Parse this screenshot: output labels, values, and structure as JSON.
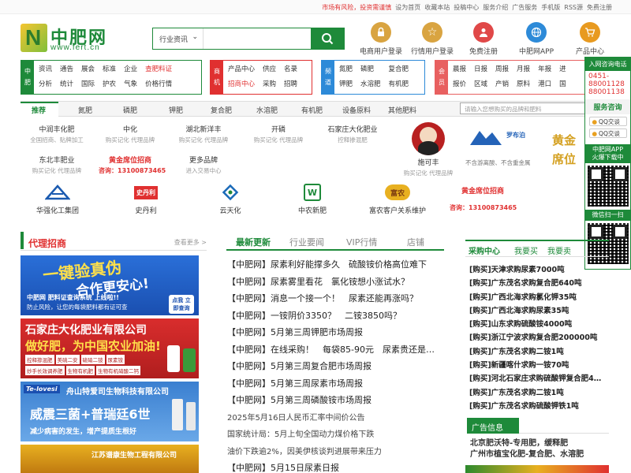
{
  "topbar": {
    "warning": "市场有风险，投资需谨慎",
    "links": [
      "设为首页",
      "收藏本站",
      "投稿中心",
      "服务介绍",
      "广告服务",
      "手机版",
      "RSS源",
      "免费注册"
    ]
  },
  "logo": {
    "name": "中肥网",
    "url": "www.fert.cn",
    "letter": "N"
  },
  "search": {
    "category": "行业资讯",
    "placeholder": ""
  },
  "quick_links": [
    {
      "label": "电商用户登录",
      "icon": "lock-icon",
      "color": "#d9a441"
    },
    {
      "label": "行情用户登录",
      "icon": "star-icon",
      "color": "#d9a441"
    },
    {
      "label": "免费注册",
      "icon": "user-icon",
      "color": "#e04848"
    },
    {
      "label": "中肥网APP",
      "icon": "globe-icon",
      "color": "#2d8ad8"
    },
    {
      "label": "产品中心",
      "icon": "cart-icon",
      "color": "#e89a20"
    }
  ],
  "nav": {
    "zhongfei": {
      "tag": [
        "中",
        "肥"
      ],
      "items": [
        "资讯",
        "通告",
        "展会",
        "标准",
        "企业",
        "查肥料证",
        "分析",
        "统计",
        "国际",
        "护农",
        "气象",
        "价格行情"
      ]
    },
    "shangji": {
      "tag": [
        "商",
        "机"
      ],
      "items": [
        "产品中心",
        "供应",
        "名录",
        "招商中心",
        "采购",
        "招聘"
      ]
    },
    "pindao": {
      "tag": [
        "频",
        "道"
      ],
      "items": [
        "氮肥",
        "磷肥",
        "复合肥",
        "钾肥",
        "水溶肥",
        "有机肥"
      ]
    },
    "huiyuan": {
      "tag": [
        "会",
        "员"
      ],
      "items": [
        "晨报",
        "日报",
        "周报",
        "月报",
        "年报",
        "进",
        "报价",
        "区域",
        "产销",
        "原料",
        "港口",
        "国"
      ]
    }
  },
  "rec_tabs": [
    "推荐",
    "氮肥",
    "磷肥",
    "钾肥",
    "复合肥",
    "水溶肥",
    "有机肥",
    "设备原料",
    "其他肥料"
  ],
  "rec_search_placeholder": "请输入您想购买的品牌和肥料",
  "brands_row1": [
    {
      "name": "中润丰化肥",
      "sub": "全国招商、贴牌加工"
    },
    {
      "name": "中化",
      "sub": "购买记化 代理品牌"
    },
    {
      "name": "湖北新洋丰",
      "sub": "购买记化 代理品牌"
    },
    {
      "name": "开磷",
      "sub": "购买记化 代理品牌"
    },
    {
      "name": "石家庄大化肥业",
      "sub": "控释掺混肥"
    }
  ],
  "brands_row2": [
    {
      "name": "东北丰肥业",
      "sub": "购买记化 代理品牌"
    },
    {
      "name": "黄金席位招商",
      "sub": "咨询：13100873465"
    },
    {
      "name": "更多品牌",
      "sub": "进入交易中心"
    }
  ],
  "brand_feature": {
    "name": "施可丰",
    "sub": "购买记化 代理品牌",
    "luobu_text": "不含游离酸、不含重金属",
    "luobu_logo": "罗布泊",
    "gold_text": "黄金席位招商"
  },
  "brand_logos": [
    "华强化工集团",
    "史丹利",
    "云天化",
    "中农新肥",
    "富农客户关系维护"
  ],
  "brand_logos_cta": {
    "name": "黄金席位招商",
    "sub": "咨询：13100873465"
  },
  "float": {
    "header": "入网咨询电话",
    "phones": [
      "0451-",
      "88001128",
      "88001138"
    ],
    "service": "服务咨询",
    "qq": [
      "QQ交谈",
      "QQ交谈"
    ],
    "app": [
      "中肥网APP",
      "火爆下载中"
    ],
    "wechat": "微信扫一扫"
  },
  "agency": {
    "title": "代理招商",
    "more": "查看更多 >"
  },
  "ads": {
    "ad1": {
      "line1": "一键验真伪",
      "line2": "合作更安心!",
      "line3": "中肥网 肥料证查询系统 上线啦!!",
      "line4": "防止风险，让您的每袋肥料都有证可查",
      "line5": "点我 立即查询"
    },
    "ad2": {
      "line1": "石家庄大化肥业有限公司",
      "line2": "做好肥，为中国农业加油!",
      "tags": [
        "控释掺混肥",
        "美硫二安",
        "硫硝二铵",
        "尿素铵",
        "妙手长效调养肥",
        "生物有机肥",
        "生物有机硝酸二钙"
      ]
    },
    "ad3": {
      "line1": "舟山特爱司生物科技有限公司",
      "line2": "威震三菌+普瑞廷6世",
      "line3": "减少病害的发生，增产提质生根好",
      "brand": "Te-lovesi"
    },
    "ad4": {
      "line1": "江苏谱康生物工程有限公司"
    }
  },
  "news_tabs": [
    "最新更新",
    "行业要闻",
    "VIP行情",
    "店铺"
  ],
  "news": [
    "【中肥网】尿素利好能撑多久　硫酸铵价格高位难下",
    "【中肥网】尿素雾里看花　氯化铵想小涨试水？",
    "【中肥网】消息一个接一个！　尿素还能再涨吗？",
    "【中肥网】一铵阴价3350？　二铵3850吗？",
    "【中肥网】5月第三周钾肥市场周报",
    "【中肥网】在线采购！　每袋85-90元　尿素贵还是…",
    "【中肥网】5月第三周复合肥市场周报",
    "【中肥网】5月第三周尿素市场周报",
    "【中肥网】5月第三周磷酸铵市场周报",
    "2025年5月16日人民币汇率中间价公告",
    "国家统计局：5月上旬全国动力煤价格下跌",
    "油价下跌逾2%，因美伊核谈判进展带来压力",
    "【中肥网】5月15日尿素日报"
  ],
  "purchase_tabs": [
    "采购中心",
    "我要买",
    "我要卖"
  ],
  "purchases": [
    "[购买]天津求购尿素7000吨",
    "[购买]广东茂名求购复合肥640吨",
    "[购买]广西北海求购氯化钾35吨",
    "[购买]广西北海求购尿素35吨",
    "[购买]山东求购硫酸铵4000吨",
    "[购买]浙江宁波求购复合肥200000吨",
    "[购买]广东茂名求购二铵1吨",
    "[购买]新疆喀什求购一铵70吨",
    "[购买]河北石家庄求购硫酸钾复合肥4…",
    "[购买]广东茂名求购二铵1吨",
    "[购买]广东茂名求购硫酸钾铁1吨"
  ],
  "ad_info": {
    "title": "广告信息",
    "lines": [
      "北京肥沃特-专用肥，缓释肥",
      "广州市植宝化肥-复合肥、水溶肥"
    ]
  }
}
